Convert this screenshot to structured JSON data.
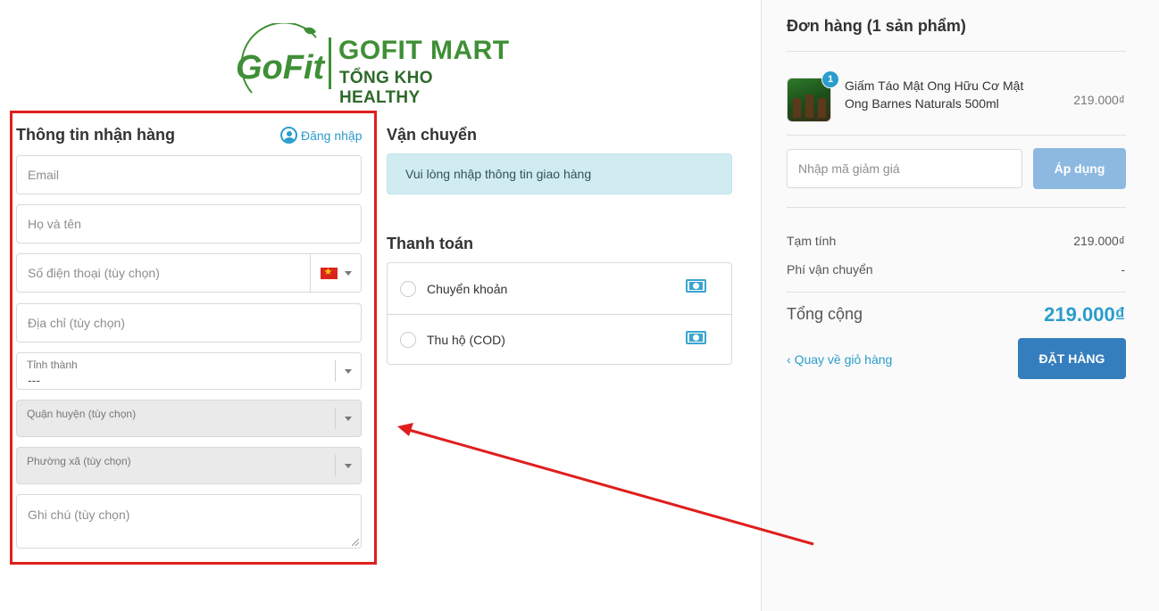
{
  "logo": {
    "mark": "GoFit",
    "brand": "GOFIT MART",
    "tagline": "TỔNG KHO HEALTHY"
  },
  "customer": {
    "title": "Thông tin nhận hàng",
    "login_label": "Đăng nhập",
    "email_placeholder": "Email",
    "name_placeholder": "Họ và tên",
    "phone_placeholder": "Số điện thoại (tùy chọn)",
    "address_placeholder": "Địa chỉ (tùy chọn)",
    "province_label": "Tỉnh thành",
    "province_value": "---",
    "district_label": "Quận huyện (tùy chọn)",
    "ward_label": "Phường xã (tùy chọn)",
    "note_placeholder": "Ghi chú (tùy chọn)"
  },
  "shipping": {
    "title": "Vận chuyển",
    "notice": "Vui lòng nhập thông tin giao hàng"
  },
  "payment": {
    "title": "Thanh toán",
    "options": [
      {
        "label": "Chuyển khoản",
        "icon": "cash-icon"
      },
      {
        "label": "Thu hộ (COD)",
        "icon": "cash-icon"
      }
    ]
  },
  "order": {
    "title": "Đơn hàng (1 sản phẩm)",
    "item": {
      "qty": "1",
      "name": "Giấm Táo Mật Ong Hữu Cơ Mật Ong Barnes Naturals 500ml",
      "price": "219.000₫"
    },
    "discount_placeholder": "Nhập mã giảm giá",
    "apply_label": "Áp dụng",
    "subtotal_label": "Tạm tính",
    "subtotal_value": "219.000₫",
    "shipping_fee_label": "Phí vận chuyển",
    "shipping_fee_value": "-",
    "total_label": "Tổng cộng",
    "total_value": "219.000₫",
    "back_label": "Quay về giỏ hàng",
    "place_order_label": "ĐẶT HÀNG"
  },
  "colors": {
    "accent": "#2a9dcc",
    "brand_green": "#3f8f36",
    "highlight_red": "#e01e1e"
  }
}
